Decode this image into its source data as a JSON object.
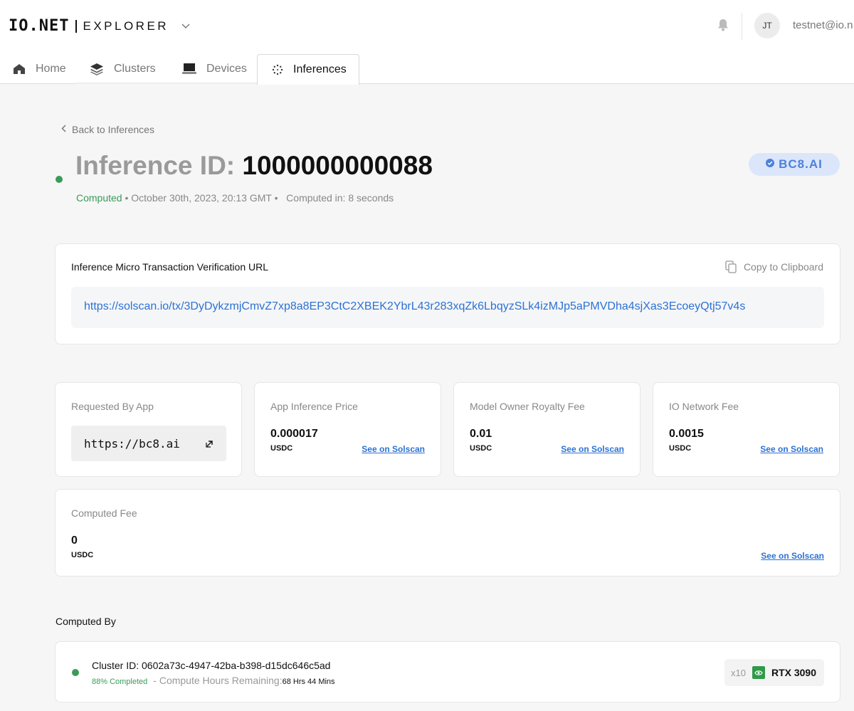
{
  "header": {
    "logo": "IO.NET",
    "product": "EXPLORER",
    "user_initials": "JT",
    "user_email": "testnet@io.n",
    "icons": {
      "notifications": "bell-icon",
      "product_menu": "chevron-down-icon"
    }
  },
  "tabs": [
    {
      "label": "Home",
      "icon": "home-icon",
      "active": false
    },
    {
      "label": "Clusters",
      "icon": "layers-icon",
      "active": false
    },
    {
      "label": "Devices",
      "icon": "monitor-icon",
      "active": false
    },
    {
      "label": "Inferences",
      "icon": "dots-circle-icon",
      "active": true
    }
  ],
  "back_link": "Back to Inferences",
  "inference": {
    "id_label": "Inference ID:",
    "id_value": "1000000000088",
    "status": "Computed",
    "date": "October 30th, 2023, 20:13 GMT",
    "computed_in": "Computed in: 8 seconds",
    "app_badge": "BC8.AI"
  },
  "verification": {
    "title": "Inference Micro Transaction Verification URL",
    "copy_label": "Copy to Clipboard",
    "url": "https://solscan.io/tx/3DyDykzmjCmvZ7xp8a8EP3CtC2XBEK2YbrL43r283xqZk6LbqyzSLk4izMJp5aPMVDha4sjXas3EcoeyQtj57v4s"
  },
  "stats": {
    "requested_by": {
      "label": "Requested By App",
      "value": "https://bc8.ai"
    },
    "app_price": {
      "label": "App Inference Price",
      "value": "0.000017",
      "unit": "USDC",
      "link": "See on Solscan"
    },
    "royalty_fee": {
      "label": "Model Owner Royalty Fee",
      "value": "0.01",
      "unit": "USDC",
      "link": "See on Solscan"
    },
    "network_fee": {
      "label": "IO Network Fee",
      "value": "0.0015",
      "unit": "USDC",
      "link": "See on Solscan"
    },
    "computed_fee": {
      "label": "Computed Fee",
      "value": "0",
      "unit": "USDC",
      "link": "See on Solscan"
    }
  },
  "computed_by": {
    "title": "Computed By",
    "cluster_id": "Cluster ID: 0602a73c-4947-42ba-b398-d15dc646c5ad",
    "completed": "88% Completed",
    "hours_label": "- Compute Hours Remaining:",
    "hours_value": "68 Hrs 44 Mins",
    "gpu_count": "x10",
    "gpu_name": "RTX 3090"
  },
  "colors": {
    "accent": "#2d72d2",
    "success": "#3a9b5a",
    "badge_bg": "#dbe6fb"
  }
}
